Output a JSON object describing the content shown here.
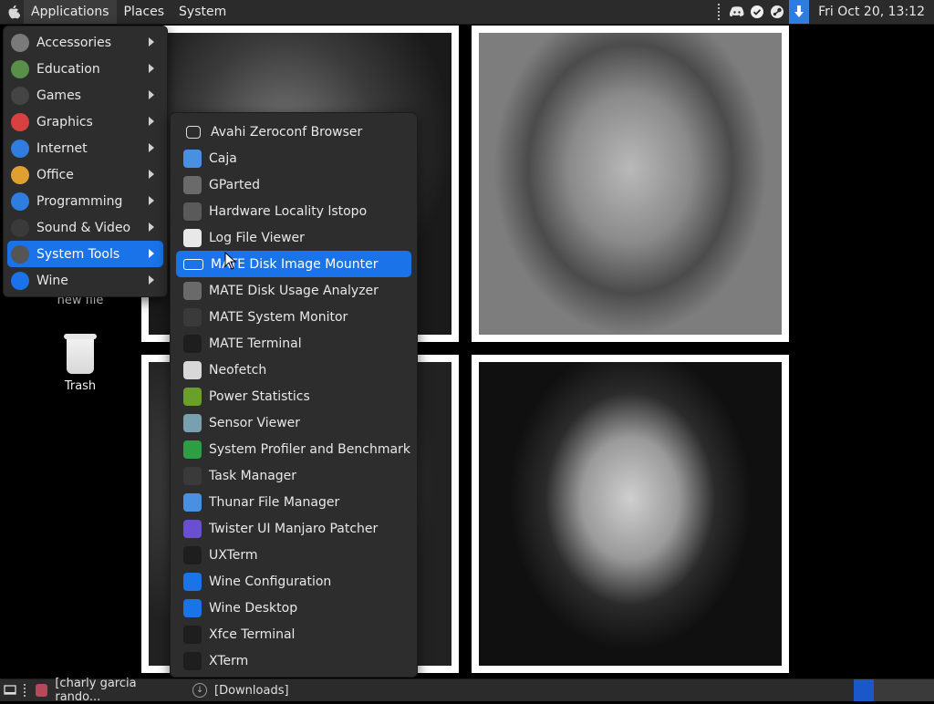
{
  "top_panel": {
    "menus": [
      "Applications",
      "Places",
      "System"
    ],
    "clock": "Fri Oct 20, 13:12",
    "tray_icons": [
      "discord-icon",
      "check-circle-icon",
      "steam-icon",
      "download-icon"
    ]
  },
  "desktop_icons": [
    {
      "label": "new file",
      "icon": "file-icon"
    },
    {
      "label": "Trash",
      "icon": "trash-icon"
    }
  ],
  "main_menu": [
    {
      "label": "Accessories",
      "icon": "accessories-icon",
      "color": "#7a7a7a"
    },
    {
      "label": "Education",
      "icon": "education-icon",
      "color": "#5a8f4a"
    },
    {
      "label": "Games",
      "icon": "games-icon",
      "color": "#444444"
    },
    {
      "label": "Graphics",
      "icon": "graphics-icon",
      "color": "#d94040"
    },
    {
      "label": "Internet",
      "icon": "internet-icon",
      "color": "#2f7de1"
    },
    {
      "label": "Office",
      "icon": "office-icon",
      "color": "#e0a030"
    },
    {
      "label": "Programming",
      "icon": "programming-icon",
      "color": "#2f7de1"
    },
    {
      "label": "Sound & Video",
      "icon": "sound-video-icon",
      "color": "#3a3a3a"
    },
    {
      "label": "System Tools",
      "icon": "system-tools-icon",
      "color": "#555555",
      "selected": true
    },
    {
      "label": "Wine",
      "icon": "wine-icon",
      "color": "#1a73e8"
    }
  ],
  "sub_menu": [
    {
      "label": "Avahi Zeroconf Browser",
      "icon": "avahi-icon",
      "color": "#2d2d2d"
    },
    {
      "label": "Caja",
      "icon": "caja-icon",
      "color": "#4a90e2"
    },
    {
      "label": "GParted",
      "icon": "gparted-icon",
      "color": "#6a6a6a"
    },
    {
      "label": "Hardware Locality lstopo",
      "icon": "lstopo-icon",
      "color": "#5a5a5a"
    },
    {
      "label": "Log File Viewer",
      "icon": "log-viewer-icon",
      "color": "#e8e8e8"
    },
    {
      "label": "MATE Disk Image Mounter",
      "icon": "disk-mounter-icon",
      "color": "#1a73e8",
      "selected": true
    },
    {
      "label": "MATE Disk Usage Analyzer",
      "icon": "disk-usage-icon",
      "color": "#6a6a6a"
    },
    {
      "label": "MATE System Monitor",
      "icon": "system-monitor-icon",
      "color": "#3a3a3a"
    },
    {
      "label": "MATE Terminal",
      "icon": "terminal-icon",
      "color": "#1e1e1e"
    },
    {
      "label": "Neofetch",
      "icon": "neofetch-icon",
      "color": "#d8d8d8"
    },
    {
      "label": "Power Statistics",
      "icon": "power-statistics-icon",
      "color": "#6a9f2a"
    },
    {
      "label": "Sensor Viewer",
      "icon": "sensor-viewer-icon",
      "color": "#7a9fb0"
    },
    {
      "label": "System Profiler and Benchmark",
      "icon": "system-profiler-icon",
      "color": "#2e9e44"
    },
    {
      "label": "Task Manager",
      "icon": "task-manager-icon",
      "color": "#3a3a3a"
    },
    {
      "label": "Thunar File Manager",
      "icon": "thunar-icon",
      "color": "#4a90e2"
    },
    {
      "label": "Twister UI Manjaro Patcher",
      "icon": "twister-icon",
      "color": "#6a4fd0"
    },
    {
      "label": "UXTerm",
      "icon": "uxterm-icon",
      "color": "#1e1e1e"
    },
    {
      "label": "Wine Configuration",
      "icon": "wine-config-icon",
      "color": "#1a73e8"
    },
    {
      "label": "Wine Desktop",
      "icon": "wine-desktop-icon",
      "color": "#1a73e8"
    },
    {
      "label": "Xfce Terminal",
      "icon": "xfce-terminal-icon",
      "color": "#1e1e1e"
    },
    {
      "label": "XTerm",
      "icon": "xterm-icon",
      "color": "#1e1e1e"
    }
  ],
  "bottom_panel": {
    "tasks": [
      {
        "label": "[charly garcia rando...",
        "icon": "browser-icon"
      },
      {
        "label": "[Downloads]",
        "icon": "downloads-icon"
      }
    ]
  }
}
